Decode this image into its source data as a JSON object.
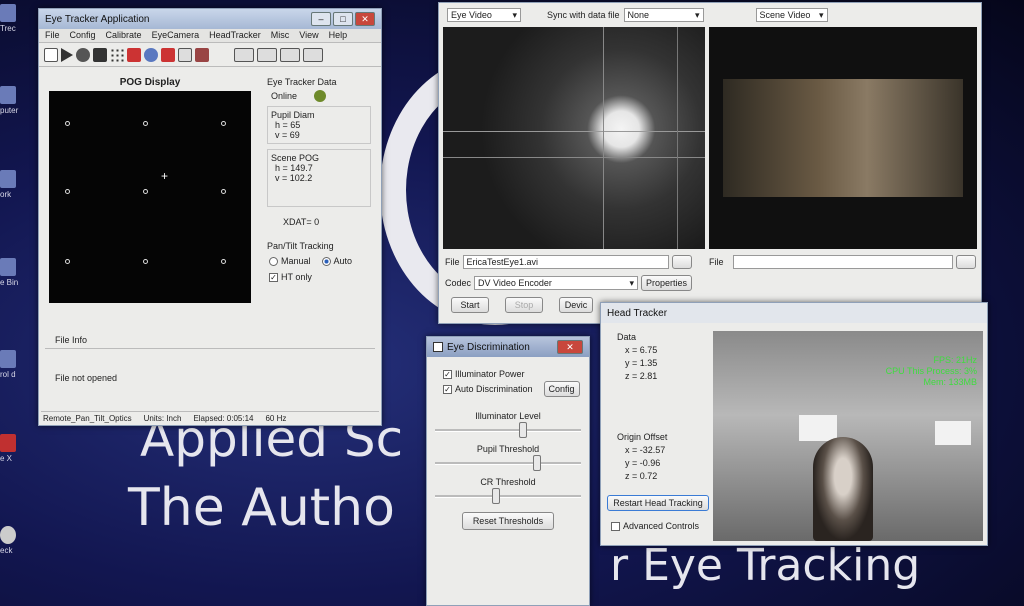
{
  "desktop": {
    "icons": [
      "Trec",
      "puter",
      "ork",
      "e Bin",
      "rol\nd",
      "e\nX",
      "eck"
    ],
    "line1": "Applied Sc",
    "line2": "The Autho",
    "line2b": "r Eye Tracking"
  },
  "main_window": {
    "title": "Eye Tracker Application",
    "menu": [
      "File",
      "Config",
      "Calibrate",
      "EyeCamera",
      "HeadTracker",
      "Misc",
      "View",
      "Help"
    ],
    "pog_title": "POG Display",
    "eye_data_label": "Eye Tracker Data",
    "status": "Online",
    "status_color": "#6e8a2a",
    "pupil_label": "Pupil Diam",
    "pupil_h": "h =  65",
    "pupil_v": "v =  69",
    "scene_label": "Scene POG",
    "scene_h": "h =  149.7",
    "scene_v": "v =  102.2",
    "xdat": "XDAT= 0",
    "pantilt_label": "Pan/Tilt Tracking",
    "manual": "Manual",
    "auto": "Auto",
    "ht_only": "HT only",
    "file_info": "File Info",
    "file_status": "File not opened",
    "status_bar": [
      "Remote_Pan_Tilt_Optics",
      "Units: Inch",
      "Elapsed: 0:05:14",
      "60 Hz"
    ]
  },
  "video_window": {
    "eye_video": "Eye Video",
    "sync_label": "Sync with data file",
    "sync_value": "None",
    "scene_video": "Scene Video",
    "file_label": "File",
    "file_value": "EricaTestEye1.avi",
    "codec_label": "Codec",
    "codec_value": "DV Video Encoder",
    "properties": "Properties",
    "start": "Start",
    "stop": "Stop",
    "device": "Devic",
    "file2_label": "File"
  },
  "eye_disc": {
    "title": "Eye Discrimination",
    "illuminator_power": "Illuminator Power",
    "auto_disc": "Auto Discrimination",
    "config": "Config",
    "illum_level": "Illuminator Level",
    "pupil_threshold": "Pupil Threshold",
    "cr_threshold": "CR Threshold",
    "reset": "Reset Thresholds",
    "illum_level_val": 0.6,
    "pupil_threshold_val": 0.7,
    "cr_threshold_val": 0.42
  },
  "head_tracker": {
    "title": "Head Tracker",
    "data_label": "Data",
    "x": "x =   6.75",
    "y": "y =   1.35",
    "z": "z =   2.81",
    "origin_label": "Origin Offset",
    "ox": "x =  -32.57",
    "oy": "y =   -0.96",
    "oz": "z =   0.72",
    "restart": "Restart Head Tracking",
    "advanced": "Advanced Controls",
    "fps": "FPS: 21Hz",
    "cpu": "CPU This Process: 3%",
    "mem": "Mem: 133MB",
    "overlay_color": "#3fdc3f"
  }
}
